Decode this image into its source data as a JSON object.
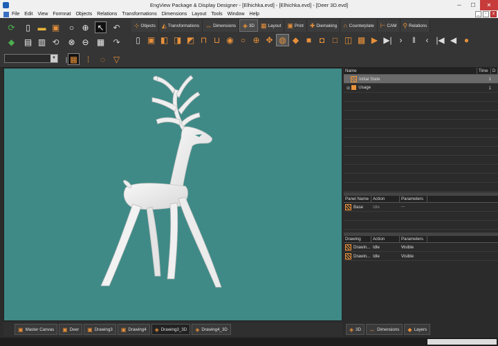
{
  "window": {
    "title": "EngView Package & Display Designer - [Elhichka.evd] - [Elhichka.evd] - [Deer 3D.evd]"
  },
  "menu": [
    "File",
    "Edit",
    "View",
    "Formnat",
    "Objects",
    "Relations",
    "Transformations",
    "Dimensions",
    "Layout",
    "Tools",
    "Window",
    "Help"
  ],
  "ribbon_tabs": [
    {
      "label": "Objects",
      "icon": "objects-icon"
    },
    {
      "label": "Transformations",
      "icon": "transformations-icon"
    },
    {
      "label": "Dimensions",
      "icon": "dimensions-icon"
    },
    {
      "label": "3D",
      "icon": "cube-icon"
    },
    {
      "label": "Layout",
      "icon": "layout-icon"
    },
    {
      "label": "Print",
      "icon": "print-icon"
    },
    {
      "label": "Diemaking",
      "icon": "diemaking-icon"
    },
    {
      "label": "Counterplate",
      "icon": "counterplate-icon"
    },
    {
      "label": "CAM",
      "icon": "cam-icon"
    },
    {
      "label": "Relations",
      "icon": "relations-icon"
    }
  ],
  "history_grid": {
    "headers": [
      "Name",
      "Time",
      "D"
    ],
    "rows": [
      {
        "name": "Initial State",
        "time": "1",
        "selected": true
      },
      {
        "name": "Usage",
        "time": "1",
        "expandable": true
      }
    ]
  },
  "panel_grid": {
    "headers": [
      "Panel Name",
      "Action",
      "Parameters ..."
    ],
    "rows": [
      {
        "name": "Base",
        "action": "Idle",
        "params": ""
      }
    ]
  },
  "drawing_grid": {
    "headers": [
      "Drawing",
      "Action",
      "Parameters ..."
    ],
    "rows": [
      {
        "name": "Drawin...",
        "action": "Idle",
        "params": "Visible"
      },
      {
        "name": "Drawin...",
        "action": "Idle",
        "params": "Visible"
      }
    ]
  },
  "bottom_tabs": [
    "Master Canvas",
    "Deer",
    "Drawing3",
    "Drawing4",
    "Drawing3_3D",
    "Drawing4_3D"
  ],
  "right_tabs": [
    "3D",
    "Dimensions",
    "Layers"
  ],
  "colors": {
    "viewport_bg": "#3f8a87",
    "accent": "#e8913a",
    "model": "#f2f2f2"
  }
}
